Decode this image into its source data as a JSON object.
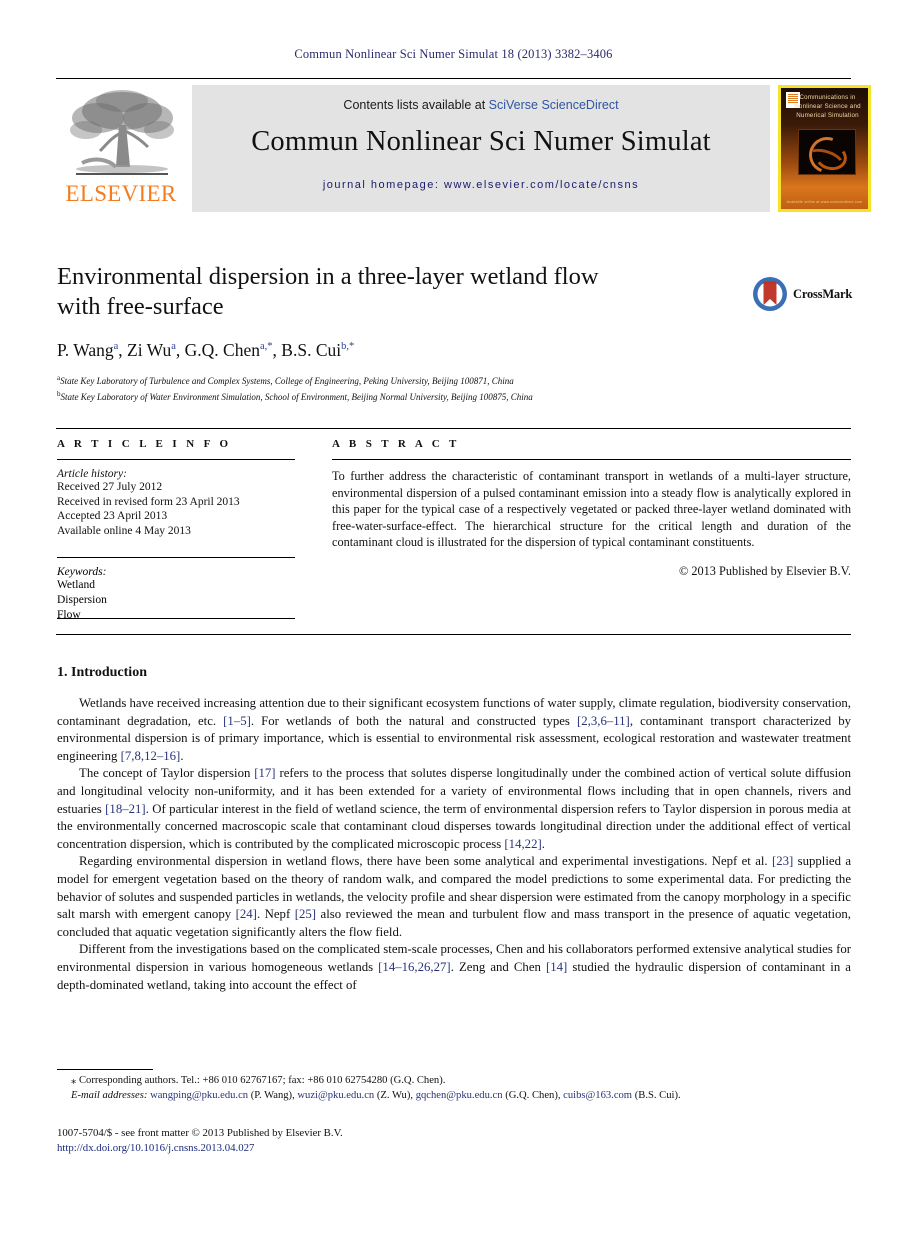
{
  "running_head": "Commun Nonlinear Sci Numer Simulat 18 (2013) 3382–3406",
  "masthead": {
    "contents_prefix": "Contents lists available at ",
    "sciencedirect": "SciVerse ScienceDirect",
    "journal_title": "Commun Nonlinear Sci Numer Simulat",
    "homepage": "journal homepage: www.elsevier.com/locate/cnsns",
    "publisher_wordmark": "ELSEVIER",
    "cover_title": "Communications in Nonlinear Science and Numerical Simulation",
    "cover_footer": "Available online at www.sciencedirect.com"
  },
  "article": {
    "title_line1": "Environmental dispersion in a three-layer wetland flow",
    "title_line2": "with free-surface",
    "authors": [
      {
        "name": "P. Wang",
        "sup": "a"
      },
      {
        "name": "Zi Wu",
        "sup": "a"
      },
      {
        "name": "G.Q. Chen",
        "sup": "a,*"
      },
      {
        "name": "B.S. Cui",
        "sup": "b,*"
      }
    ],
    "affiliations": [
      {
        "sup": "a",
        "text": "State Key Laboratory of Turbulence and Complex Systems, College of Engineering, Peking University, Beijing 100871, China"
      },
      {
        "sup": "b",
        "text": "State Key Laboratory of Water Environment Simulation, School of Environment, Beijing Normal University, Beijing 100875, China"
      }
    ]
  },
  "crossmark": {
    "label": "CrossMark"
  },
  "info": {
    "heading": "A R T I C L E    I N F O",
    "history_label": "Article history:",
    "history": [
      "Received 27 July 2012",
      "Received in revised form 23 April 2013",
      "Accepted 23 April 2013",
      "Available online 4 May 2013"
    ],
    "keywords_label": "Keywords:",
    "keywords": [
      "Wetland",
      "Dispersion",
      "Flow"
    ]
  },
  "abstract": {
    "heading": "A B S T R A C T",
    "text": "To further address the characteristic of contaminant transport in wetlands of a multi-layer structure, environmental dispersion of a pulsed contaminant emission into a steady flow is analytically explored in this paper for the typical case of a respectively vegetated or packed three-layer wetland dominated with free-water-surface-effect. The hierarchical structure for the critical length and duration of the contaminant cloud is illustrated for the dispersion of typical contaminant constituents.",
    "copyright": "© 2013 Published by Elsevier B.V."
  },
  "body": {
    "section_heading": "1. Introduction",
    "paragraphs": [
      "Wetlands have received increasing attention due to their significant ecosystem functions of water supply, climate regulation, biodiversity conservation, contaminant degradation, etc. [1–5]. For wetlands of both the natural and constructed types [2,3,6–11], contaminant transport characterized by environmental dispersion is of primary importance, which is essential to environmental risk assessment, ecological restoration and wastewater treatment engineering [7,8,12–16].",
      "The concept of Taylor dispersion [17] refers to the process that solutes disperse longitudinally under the combined action of vertical solute diffusion and longitudinal velocity non-uniformity, and it has been extended for a variety of environmental flows including that in open channels, rivers and estuaries [18–21]. Of particular interest in the field of wetland science, the term of environmental dispersion refers to Taylor dispersion in porous media at the environmentally concerned macroscopic scale that contaminant cloud disperses towards longitudinal direction under the additional effect of vertical concentration dispersion, which is contributed by the complicated microscopic process [14,22].",
      "Regarding environmental dispersion in wetland flows, there have been some analytical and experimental investigations. Nepf et al. [23] supplied a model for emergent vegetation based on the theory of random walk, and compared the model predictions to some experimental data. For predicting the behavior of solutes and suspended particles in wetlands, the velocity profile and shear dispersion were estimated from the canopy morphology in a specific salt marsh with emergent canopy [24]. Nepf [25] also reviewed the mean and turbulent flow and mass transport in the presence of aquatic vegetation, concluded that aquatic vegetation significantly alters the flow field.",
      "Different from the investigations based on the complicated stem-scale processes, Chen and his collaborators performed extensive analytical studies for environmental dispersion in various homogeneous wetlands [14–16,26,27]. Zeng and Chen [14] studied the hydraulic dispersion of contaminant in a depth-dominated wetland, taking into account the effect of"
    ]
  },
  "footnotes": {
    "corresponding": "Corresponding authors. Tel.: +86 010 62767167; fax: +86 010 62754280 (G.Q. Chen).",
    "corresponding_marker": "⁎",
    "email_label": "E-mail addresses:",
    "emails": [
      {
        "address": "wangping@pku.edu.cn",
        "owner": "(P. Wang)"
      },
      {
        "address": "wuzi@pku.edu.cn",
        "owner": "(Z. Wu)"
      },
      {
        "address": "gqchen@pku.edu.cn",
        "owner": "(G.Q. Chen)"
      },
      {
        "address": "cuibs@163.com",
        "owner": "(B.S. Cui)"
      }
    ]
  },
  "footer": {
    "issn_line": "1007-5704/$ - see front matter © 2013 Published by Elsevier B.V.",
    "doi_line": "http://dx.doi.org/10.1016/j.cnsns.2013.04.027"
  }
}
